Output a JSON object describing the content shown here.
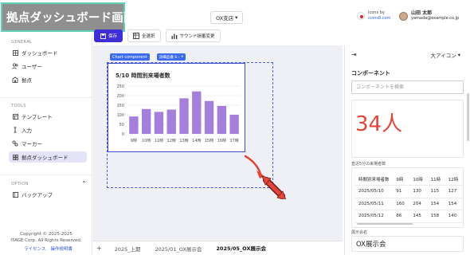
{
  "app": {
    "title": "拠点ダッシュボード画面",
    "store_select": "OX支店",
    "icons_credit_line1": "Icons by",
    "icons_credit_link": "icons8.com",
    "user_name": "山田 太郎",
    "user_email": "yamada@example.co.jp"
  },
  "toolbar": {
    "save_label": "保存",
    "select_all_label": "全選択",
    "sound_label": "サウンド損番変更"
  },
  "sidebar": {
    "general_title": "GENERAL",
    "general_items": [
      {
        "label": "ダッシュボード",
        "icon": "grid-icon"
      },
      {
        "label": "ユーザー",
        "icon": "users-icon"
      },
      {
        "label": "拠点",
        "icon": "building-icon"
      }
    ],
    "tools_title": "TOOLS",
    "tools_items": [
      {
        "label": "テンプレート",
        "icon": "template-icon"
      },
      {
        "label": "入力",
        "icon": "text-cursor-icon"
      },
      {
        "label": "マーカー",
        "icon": "marker-icon"
      },
      {
        "label": "拠点ダッシュボード",
        "icon": "dashboard-icon",
        "active": true
      }
    ],
    "option_title": "OPTION",
    "option_items": [
      {
        "label": "バックアップ",
        "icon": "backup-icon"
      }
    ],
    "copyright_line1": "Copyright © 2025-2025",
    "copyright_line2": "ITAGE Corp. All Rights Reserved.",
    "link_license": "ライセンス",
    "link_manual": "操作説明書"
  },
  "canvas": {
    "component_tag": "Chart component",
    "component_tag2": "詳細品番 6 ›"
  },
  "chart_data": {
    "type": "bar",
    "title": "5/10 時間別来場者数",
    "categories": [
      "9時",
      "10時",
      "11時",
      "12時",
      "13時",
      "14時",
      "15時",
      "16時",
      "17時"
    ],
    "values": [
      91,
      130,
      115,
      127,
      186,
      222,
      172,
      146,
      100
    ],
    "ylim": [
      0,
      250
    ],
    "yticks": [
      "0",
      "50",
      "100",
      "150",
      "200",
      "250"
    ],
    "bar_color": "#a57fdc",
    "grid": true
  },
  "tabs": {
    "items": [
      {
        "label": "2025_上期",
        "active": false
      },
      {
        "label": "2025/01_OX展示会",
        "active": false
      },
      {
        "label": "2025/05_OX展示会",
        "active": true
      }
    ]
  },
  "panel": {
    "size_label": "大アイコン",
    "heading": "コンポーネント",
    "search_placeholder": "コンポーネントを検索",
    "big_value": "34人",
    "table_label": "直近5分の来場者数",
    "table_headers": [
      "時間別来場者数",
      "9時",
      "10時",
      "11時",
      "12時"
    ],
    "table_rows": [
      [
        "2025/05/10",
        "91",
        "130",
        "115",
        "127"
      ],
      [
        "2025/05/11",
        "160",
        "204",
        "154",
        "154"
      ],
      [
        "2025/05/12",
        "86",
        "145",
        "158",
        "140"
      ]
    ],
    "venue_label": "展示会名",
    "venue_value": "OX展示会"
  },
  "colors": {
    "accent": "#3d2ed6",
    "active_nav": "#e4e3f7",
    "big_value": "#e0463a",
    "arrow": "#e0463a"
  }
}
